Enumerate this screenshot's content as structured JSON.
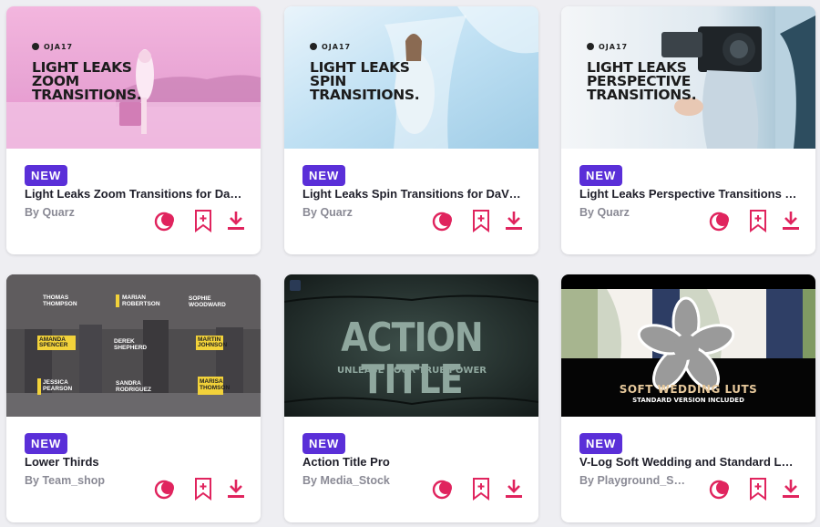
{
  "accent_color": "#e0245e",
  "badge_color": "#5a2fd8",
  "cards": [
    {
      "badge": "NEW",
      "title": "Light Leaks Zoom Transitions for DaVinci Resolve",
      "author": "By Quarz",
      "overlay_logo": "OJA17",
      "overlay_lines": [
        "LIGHT LEAKS",
        "ZOOM",
        "TRANSITIONS."
      ]
    },
    {
      "badge": "NEW",
      "title": "Light Leaks Spin Transitions for DaVinci Resolve",
      "author": "By Quarz",
      "overlay_logo": "OJA17",
      "overlay_lines": [
        "LIGHT LEAKS",
        "SPIN",
        "TRANSITIONS."
      ]
    },
    {
      "badge": "NEW",
      "title": "Light Leaks Perspective Transitions for DaVinci Resolve",
      "author": "By Quarz",
      "overlay_logo": "OJA17",
      "overlay_lines": [
        "LIGHT LEAKS",
        "PERSPECTIVE",
        "TRANSITIONS."
      ]
    },
    {
      "badge": "NEW",
      "title": "Lower Thirds",
      "author": "By Team_shop",
      "overlay_names": [
        "THOMAS THOMPSON",
        "MARIAN ROBERTSON",
        "SOPHIE WOODWARD",
        "AMANDA SPENCER",
        "DEREK SHEPHERD",
        "MARTIN JOHNSON",
        "JESSICA PEARSON",
        "SANDRA RODRIGUEZ",
        "MARISA THOMSON"
      ]
    },
    {
      "badge": "NEW",
      "title": "Action Title Pro",
      "author": "By Media_Stock",
      "overlay_title": "ACTION TITLE",
      "overlay_subtitle": "UNLEASE YOUR TRUE POWER"
    },
    {
      "badge": "NEW",
      "title": "V-Log Soft Wedding and Standard LUTs",
      "author": "By Playground_Studio",
      "overlay_title": "SOFT WEDDING LUTS",
      "overlay_subtitle": "STANDARD VERSION INCLUDED"
    }
  ],
  "icons": {
    "preview": "preview-toggle-icon",
    "bookmark": "bookmark-add-icon",
    "download": "download-icon",
    "loading": "loading-spinner-icon"
  }
}
